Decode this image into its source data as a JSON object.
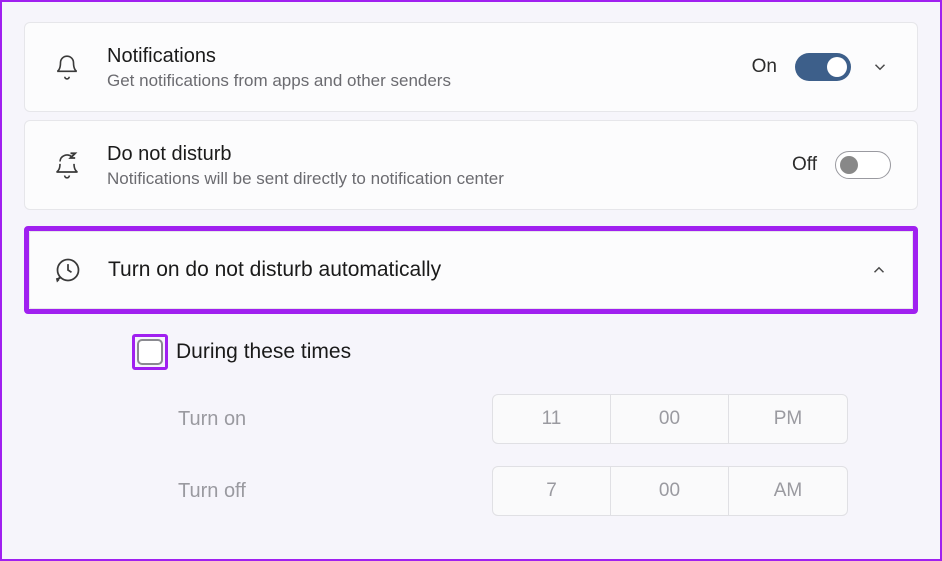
{
  "notifications": {
    "title": "Notifications",
    "subtitle": "Get notifications from apps and other senders",
    "state_label": "On",
    "toggle_on": true
  },
  "dnd": {
    "title": "Do not disturb",
    "subtitle": "Notifications will be sent directly to notification center",
    "state_label": "Off",
    "toggle_on": false
  },
  "auto_dnd": {
    "title": "Turn on do not disturb automatically"
  },
  "during_times": {
    "checkbox_checked": false,
    "label": "During these times",
    "turn_on": {
      "label": "Turn on",
      "hour": "11",
      "minute": "00",
      "ampm": "PM"
    },
    "turn_off": {
      "label": "Turn off",
      "hour": "7",
      "minute": "00",
      "ampm": "AM"
    }
  }
}
